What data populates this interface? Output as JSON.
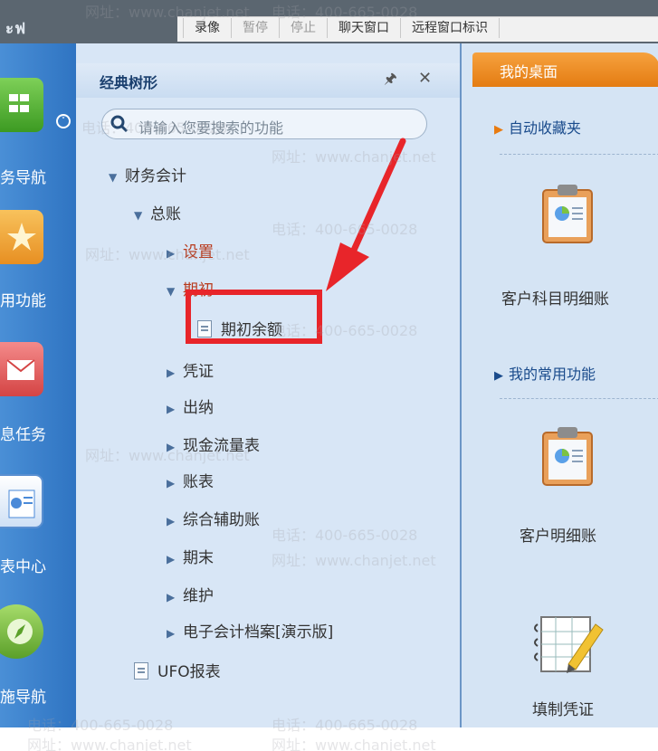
{
  "topbar": {
    "logo_text": "ะฟ",
    "toolbar_buttons": [
      {
        "label": "录像",
        "disabled": false
      },
      {
        "label": "暂停",
        "disabled": true
      },
      {
        "label": "停止",
        "disabled": true
      },
      {
        "label": "聊天窗口",
        "disabled": false
      },
      {
        "label": "远程窗口标识",
        "disabled": false
      }
    ]
  },
  "left_dock": {
    "items": [
      {
        "label": "务导航",
        "icon": "grid-icon",
        "color": "#4cae32"
      },
      {
        "label": "用功能",
        "icon": "star-icon",
        "color": "#f1a43a"
      },
      {
        "label": "息任务",
        "icon": "envelope-icon",
        "color": "#e86262"
      },
      {
        "label": "表中心",
        "icon": "report-icon",
        "color": "#4b8ad8"
      },
      {
        "label": "施导航",
        "icon": "compass-icon",
        "color": "#7cc242"
      }
    ]
  },
  "tree_panel": {
    "title": "经典树形",
    "search_placeholder": "请输入您要搜索的功能",
    "nodes": [
      {
        "label": "财务会计",
        "type": "expanded"
      },
      {
        "label": "总账",
        "type": "expanded"
      },
      {
        "label": "设置",
        "type": "collapsed"
      },
      {
        "label": "期初",
        "type": "expanded"
      },
      {
        "label": "期初余额",
        "type": "leaf"
      },
      {
        "label": "凭证",
        "type": "collapsed"
      },
      {
        "label": "出纳",
        "type": "collapsed"
      },
      {
        "label": "现金流量表",
        "type": "collapsed"
      },
      {
        "label": "账表",
        "type": "collapsed"
      },
      {
        "label": "综合辅助账",
        "type": "collapsed"
      },
      {
        "label": "期末",
        "type": "collapsed"
      },
      {
        "label": "维护",
        "type": "collapsed"
      },
      {
        "label": "电子会计档案[演示版]",
        "type": "collapsed"
      },
      {
        "label": "UFO报表",
        "type": "leaf"
      }
    ]
  },
  "desktop": {
    "tab_label": "我的桌面",
    "section_favorites": "自动收藏夹",
    "section_common": "我的常用功能",
    "apps": [
      {
        "label": "客户科目明细账",
        "icon": "clipboard-chart-icon"
      },
      {
        "label": "客户明细账",
        "icon": "clipboard-chart-icon"
      },
      {
        "label": "填制凭证",
        "icon": "notebook-pen-icon"
      }
    ]
  },
  "watermark": {
    "phone": "电话：400-665-0028",
    "site": "网址：www.chanjet.net"
  },
  "colors": {
    "accent_orange": "#e47c12",
    "highlight_red": "#e8252a",
    "panel_blue": "#d8e6f6",
    "dock_blue": "#2f74c2"
  }
}
